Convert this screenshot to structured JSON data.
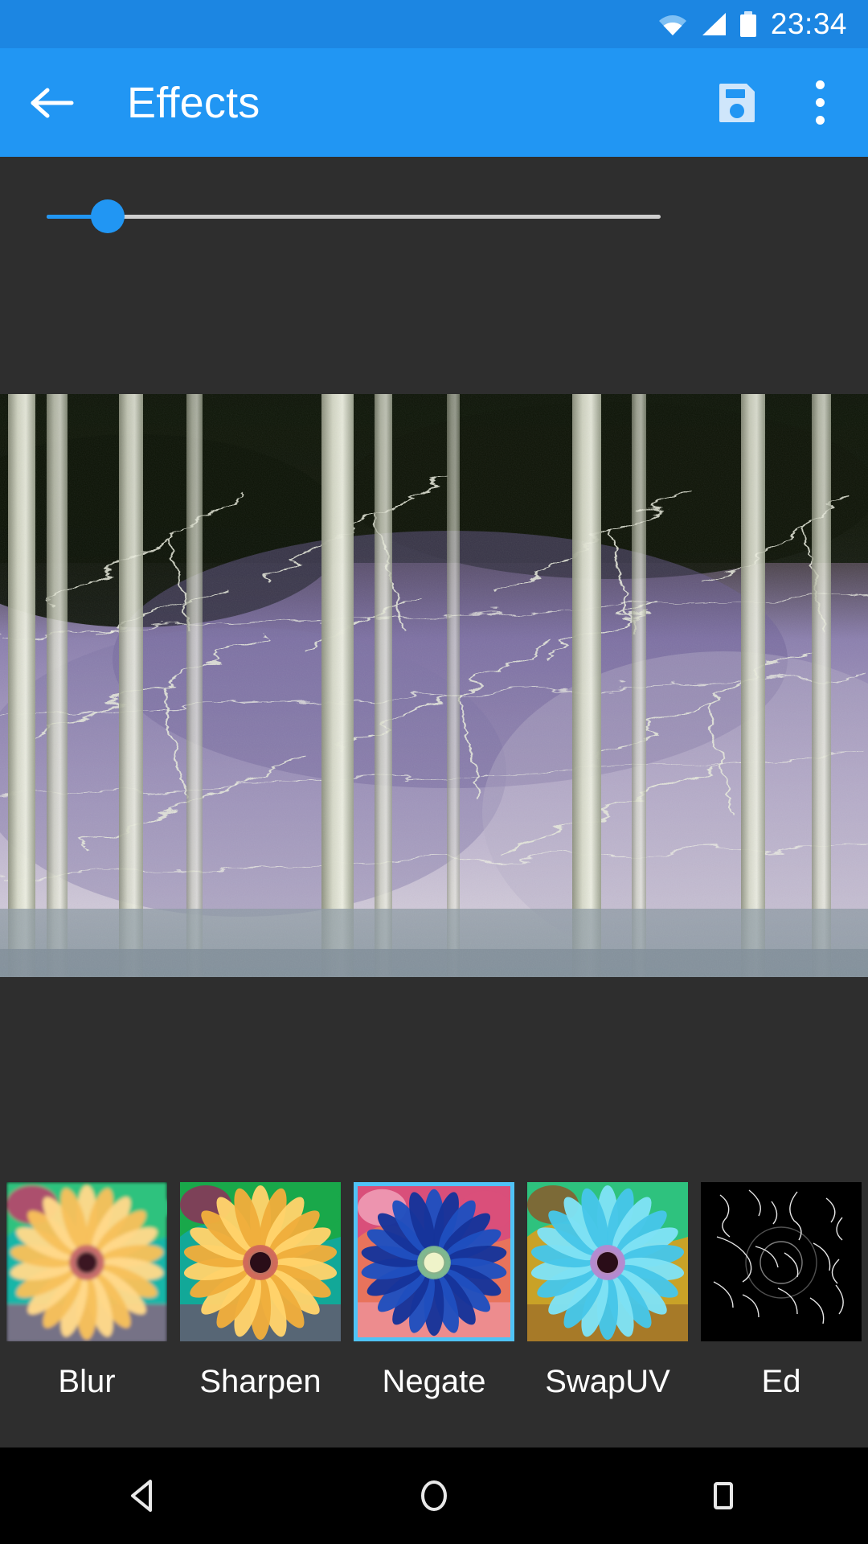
{
  "status_bar": {
    "time": "23:34",
    "icons": [
      "wifi-icon",
      "cell-signal-icon",
      "battery-icon"
    ]
  },
  "app_bar": {
    "back_icon": "arrow-left-icon",
    "title": "Effects",
    "save_icon": "save-floppy-icon",
    "overflow_icon": "more-vertical-icon"
  },
  "slider": {
    "name": "effect-intensity-slider",
    "value_percent": 10,
    "min": 0,
    "max": 100,
    "track_color": "#cfcfcf",
    "fill_color": "#2196f3",
    "thumb_color": "#2196f3"
  },
  "preview": {
    "name": "image-preview",
    "description": "negate-effect-forest-photo"
  },
  "effects": [
    {
      "label": "Blur",
      "selected": false,
      "thumb": "flower-blur"
    },
    {
      "label": "Sharpen",
      "selected": false,
      "thumb": "flower-sharpen"
    },
    {
      "label": "Negate",
      "selected": true,
      "thumb": "flower-negate"
    },
    {
      "label": "SwapUV",
      "selected": false,
      "thumb": "flower-swapuv"
    },
    {
      "label": "Ed",
      "selected": false,
      "thumb": "flower-edge"
    }
  ],
  "nav_bar": {
    "back_label": "back-triangle-icon",
    "home_label": "home-circle-icon",
    "recents_label": "recents-square-icon"
  },
  "colors": {
    "status_bar": "#1c86e2",
    "app_bar": "#2196f3",
    "background": "#2e2e2e",
    "selection": "#4fc3f7",
    "nav_bar": "#000000"
  }
}
